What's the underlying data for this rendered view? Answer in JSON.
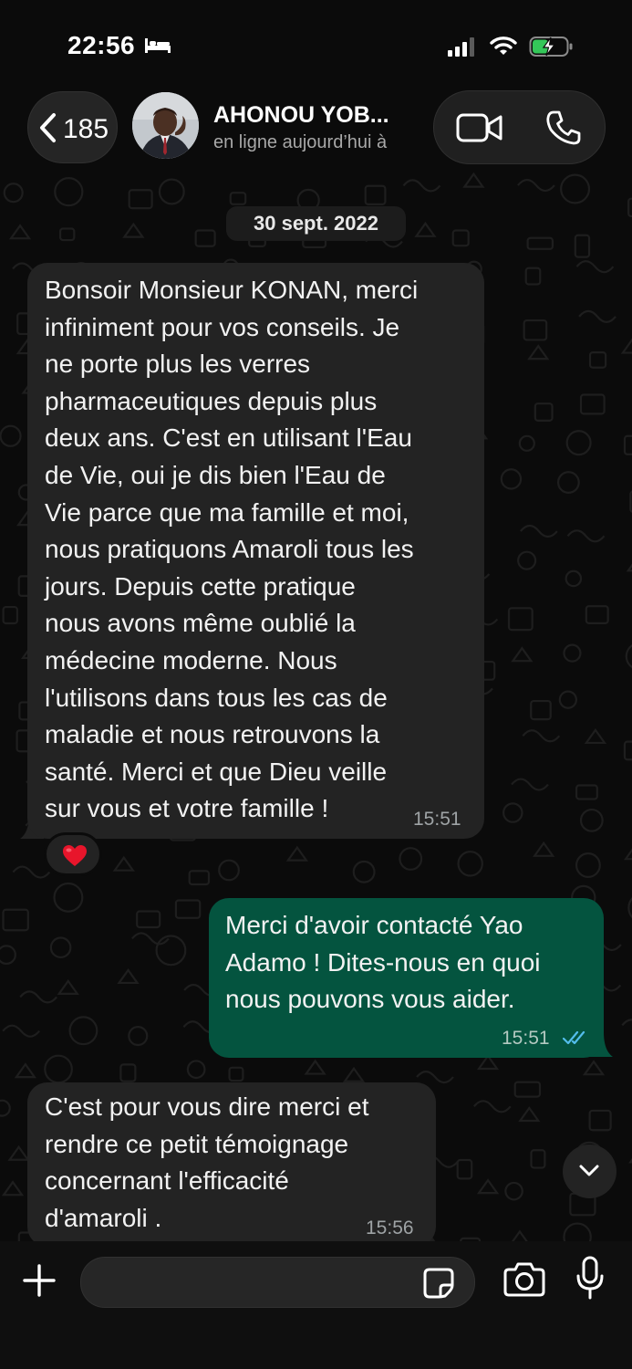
{
  "status_bar": {
    "time": "22:56",
    "icons": [
      "bed-icon",
      "signal-icon",
      "wifi-icon",
      "battery-charging-icon"
    ]
  },
  "header": {
    "back_count": "185",
    "contact_name": "AHONOU YOB...",
    "contact_status": "en ligne aujourd’hui à",
    "icons": [
      "chevron-left-icon",
      "video-call-icon",
      "phone-call-icon"
    ]
  },
  "chat": {
    "date_separator": "30 sept. 2022",
    "messages": [
      {
        "direction": "incoming",
        "lines": [
          "Bonsoir Monsieur KONAN, merci",
          "infiniment pour vos conseils. Je",
          "ne porte plus les verres",
          "pharmaceutiques depuis plus",
          "deux ans. C'est en utilisant l'Eau",
          "de Vie, oui je dis bien l'Eau de",
          "Vie parce que ma famille et moi,",
          "nous pratiquons Amaroli tous les",
          "jours. Depuis cette pratique",
          "nous avons même oublié la",
          "médecine moderne. Nous",
          "l'utilisons dans tous les cas de",
          "maladie et nous retrouvons la",
          "santé. Merci et que Dieu veille",
          "sur vous et votre famille !"
        ],
        "time": "15:51",
        "reaction": "❤️"
      },
      {
        "direction": "outgoing",
        "lines": [
          "Merci d'avoir contacté Yao",
          "Adamo ! Dites-nous en quoi",
          "nous pouvons vous aider."
        ],
        "time": "15:51",
        "status": "read"
      },
      {
        "direction": "incoming",
        "lines": [
          "C'est pour vous dire merci et",
          "rendre ce petit témoignage",
          "concernant l'efficacité",
          "d'amaroli ."
        ],
        "time": "15:56"
      }
    ]
  },
  "composer": {
    "placeholder": "",
    "icons": [
      "plus-icon",
      "sticker-icon",
      "camera-icon",
      "microphone-icon"
    ]
  },
  "colors": {
    "background": "#0b0b0b",
    "incoming_bubble": "#232323",
    "outgoing_bubble": "#04543f",
    "read_ticks": "#53bdeb",
    "battery_fill": "#34c759"
  }
}
